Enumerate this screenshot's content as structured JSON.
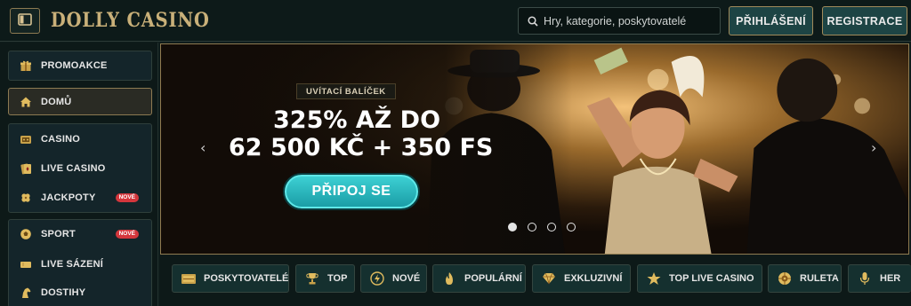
{
  "header": {
    "logo": "DOLLY CASINO",
    "search_placeholder": "Hry, kategorie, poskytovatelé",
    "login_label": "PŘIHLÁŠENÍ",
    "register_label": "REGISTRACE"
  },
  "sidebar": {
    "groups": [
      {
        "items": [
          {
            "label": "PROMOAKCE",
            "icon": "gift-icon"
          }
        ]
      },
      {
        "items": [
          {
            "label": "DOMŮ",
            "icon": "home-icon",
            "active": true
          }
        ]
      },
      {
        "items": [
          {
            "label": "CASINO",
            "icon": "casino-chip-icon"
          },
          {
            "label": "LIVE CASINO",
            "icon": "cards-icon"
          },
          {
            "label": "JACKPOTY",
            "icon": "clover-icon",
            "badge": "NOVÉ"
          }
        ]
      },
      {
        "items": [
          {
            "label": "SPORT",
            "icon": "ball-icon",
            "badge": "NOVÉ"
          },
          {
            "label": "LIVE SÁZENÍ",
            "icon": "ticket-icon"
          },
          {
            "label": "DOSTIHY",
            "icon": "horse-icon"
          }
        ]
      }
    ]
  },
  "banner": {
    "tag": "UVÍTACÍ BALÍČEK",
    "title_line1": "325% AŽ DO",
    "title_line2": "62 500 KČ + 350 FS",
    "cta_label": "PŘIPOJ SE",
    "slides_total": 4,
    "active_slide": 1
  },
  "categories": [
    {
      "label": "POSKYTOVATELÉ",
      "icon": "box-icon"
    },
    {
      "label": "TOP",
      "icon": "trophy-icon"
    },
    {
      "label": "NOVÉ",
      "icon": "lightning-icon"
    },
    {
      "label": "POPULÁRNÍ",
      "icon": "flame-icon"
    },
    {
      "label": "EXKLUZIVNÍ",
      "icon": "diamond-icon"
    },
    {
      "label": "TOP LIVE CASINO",
      "icon": "star-icon"
    },
    {
      "label": "RULETA",
      "icon": "roulette-icon"
    },
    {
      "label": "HER",
      "icon": "microphone-icon"
    }
  ],
  "colors": {
    "gold": "#c9b079",
    "teal_button": "#1d4444",
    "cta": "#2bbcc2",
    "badge": "#d4363c"
  }
}
